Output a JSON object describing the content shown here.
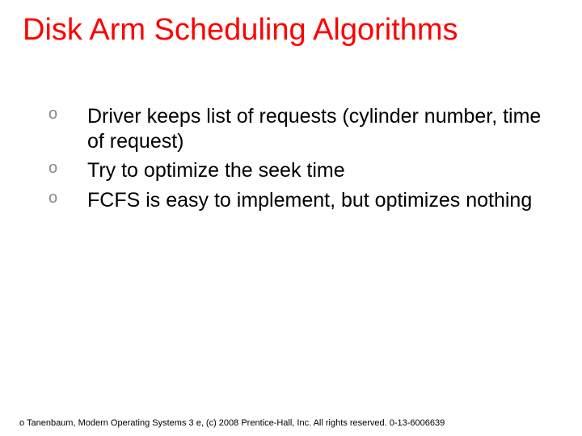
{
  "title": "Disk Arm Scheduling Algorithms",
  "bullets": [
    "Driver keeps list of requests (cylinder number, time of request)",
    "Try to optimize the seek time",
    "FCFS is easy to implement, but optimizes nothing"
  ],
  "bullet_marker": "o",
  "footer": "o Tanenbaum, Modern Operating Systems 3 e, (c) 2008 Prentice-Hall, Inc. All rights reserved. 0-13-6006639"
}
